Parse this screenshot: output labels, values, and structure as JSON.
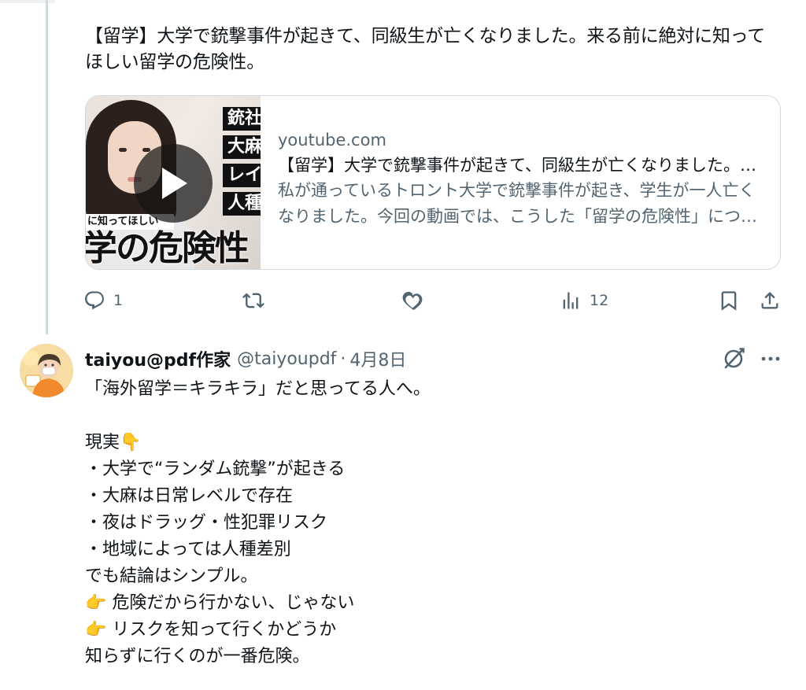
{
  "tweet1": {
    "text_line1": "【留学】大学で銃撃事件が起きて、同級生が亡くなりました。来る前に絶対に知って",
    "text_line2": "ほしい留学の危険性。",
    "card": {
      "domain": "youtube.com",
      "title": "【留学】大学で銃撃事件が起きて、同級生が亡くなりました。来る前に絶対に知ってほしい留学の危険性。",
      "description": "私が通っているトロント大学で銃撃事件が起き、学生が一人亡くなりました。今回の動画では、こうした「留学の危険性」について",
      "thumbnail_tags": [
        "銃社",
        "大麻",
        "レイ",
        "人種"
      ],
      "thumbnail_strip": "に知ってほしい",
      "thumbnail_big": "学の危険性"
    },
    "actions": {
      "reply_count": "1",
      "repost_count": "",
      "like_count": "",
      "views_count": "12"
    }
  },
  "tweet2": {
    "display_name": "taiyou@pdf作家",
    "handle": "@taiyoupdf",
    "separator": "·",
    "date": "4月8日",
    "lines": [
      "「海外留学＝キラキラ」だと思ってる人へ。",
      "",
      "現実👇",
      "・大学で“ランダム銃撃”が起きる",
      "・大麻は日常レベルで存在",
      "・夜はドラッグ・性犯罪リスク",
      "・地域によっては人種差別",
      "でも結論はシンプル。",
      "👉 危険だから行かない、じゃない",
      "👉 リスクを知って行くかどうか",
      "知らずに行くのが一番危険。"
    ]
  },
  "colors": {
    "text": "#0f1419",
    "muted": "#536471",
    "border": "#cfd9de"
  }
}
